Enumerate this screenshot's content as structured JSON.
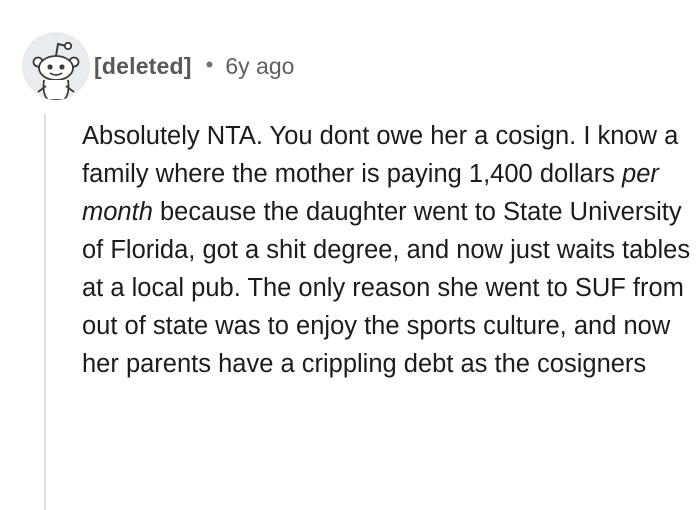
{
  "comment": {
    "author": "[deleted]",
    "separator": "•",
    "timestamp": "6y ago",
    "avatar_icon": "deleted-user-snoo-icon",
    "body_before_italic": "Absolutely NTA. You dont owe her a cosign. I know a family where the mother is paying 1,400 dollars ",
    "body_italic": "per month",
    "body_after_italic": " because the daughter went to State University of Florida, got a shit degree, and now just waits tables at a local pub. The only reason she went to SUF from out of state was to enjoy the sports culture, and now her parents have a crippling debt as the cosigners"
  },
  "colors": {
    "author": "#57585a",
    "timestamp": "#5e6163",
    "body_text": "#1c1c1c",
    "thread_line": "#dcdfe1",
    "avatar_bg": "#e9ecef"
  }
}
